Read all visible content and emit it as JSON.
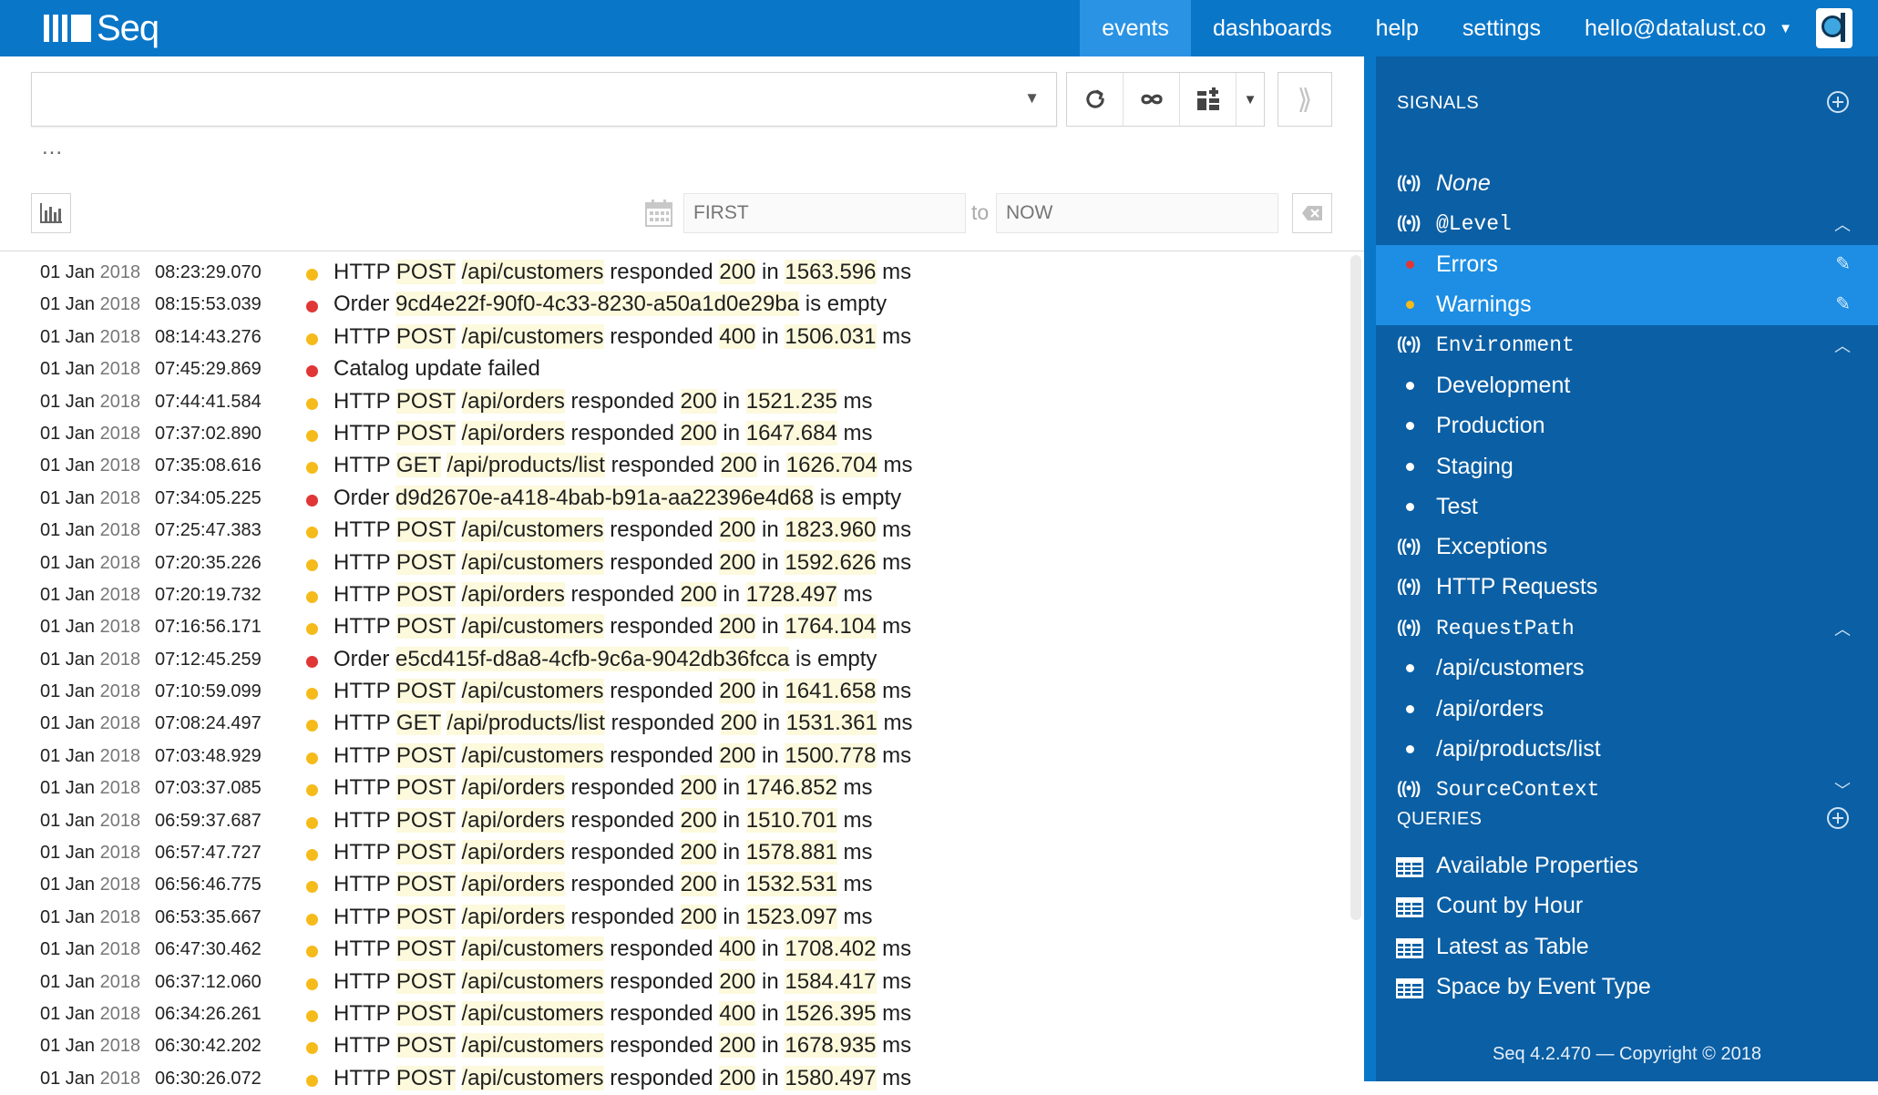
{
  "app": {
    "logo_text": "Seq",
    "nav": [
      {
        "label": "events",
        "active": true
      },
      {
        "label": "dashboards",
        "active": false
      },
      {
        "label": "help",
        "active": false
      },
      {
        "label": "settings",
        "active": false
      }
    ],
    "user": "hello@datalust.co"
  },
  "toolbar": {
    "query_value": "",
    "ellipsis": "...",
    "date_from_placeholder": "FIRST",
    "date_to_placeholder": "NOW",
    "to_label": "to"
  },
  "events": [
    {
      "date": "01 Jan",
      "year": "2018",
      "time": "08:23:29.070",
      "level": "warn",
      "segments": [
        [
          "HTTP",
          0
        ],
        [
          " ",
          0
        ],
        [
          "POST",
          1
        ],
        [
          " ",
          0
        ],
        [
          "/api/customers",
          1
        ],
        [
          " responded ",
          0
        ],
        [
          "200",
          1
        ],
        [
          " in ",
          0
        ],
        [
          "1563.596",
          1
        ],
        [
          " ms",
          0
        ]
      ]
    },
    {
      "date": "01 Jan",
      "year": "2018",
      "time": "08:15:53.039",
      "level": "err",
      "segments": [
        [
          "Order ",
          0
        ],
        [
          "9cd4e22f-90f0-4c33-8230-a50a1d0e29ba",
          1
        ],
        [
          " is empty",
          0
        ]
      ]
    },
    {
      "date": "01 Jan",
      "year": "2018",
      "time": "08:14:43.276",
      "level": "warn",
      "segments": [
        [
          "HTTP",
          0
        ],
        [
          " ",
          0
        ],
        [
          "POST",
          1
        ],
        [
          " ",
          0
        ],
        [
          "/api/customers",
          1
        ],
        [
          " responded ",
          0
        ],
        [
          "400",
          1
        ],
        [
          " in ",
          0
        ],
        [
          "1506.031",
          1
        ],
        [
          " ms",
          0
        ]
      ]
    },
    {
      "date": "01 Jan",
      "year": "2018",
      "time": "07:45:29.869",
      "level": "err",
      "segments": [
        [
          "Catalog update failed",
          0
        ]
      ]
    },
    {
      "date": "01 Jan",
      "year": "2018",
      "time": "07:44:41.584",
      "level": "warn",
      "segments": [
        [
          "HTTP",
          0
        ],
        [
          " ",
          0
        ],
        [
          "POST",
          1
        ],
        [
          " ",
          0
        ],
        [
          "/api/orders",
          1
        ],
        [
          " responded ",
          0
        ],
        [
          "200",
          1
        ],
        [
          " in ",
          0
        ],
        [
          "1521.235",
          1
        ],
        [
          " ms",
          0
        ]
      ]
    },
    {
      "date": "01 Jan",
      "year": "2018",
      "time": "07:37:02.890",
      "level": "warn",
      "segments": [
        [
          "HTTP",
          0
        ],
        [
          " ",
          0
        ],
        [
          "POST",
          1
        ],
        [
          " ",
          0
        ],
        [
          "/api/orders",
          1
        ],
        [
          " responded ",
          0
        ],
        [
          "200",
          1
        ],
        [
          " in ",
          0
        ],
        [
          "1647.684",
          1
        ],
        [
          " ms",
          0
        ]
      ]
    },
    {
      "date": "01 Jan",
      "year": "2018",
      "time": "07:35:08.616",
      "level": "warn",
      "segments": [
        [
          "HTTP",
          0
        ],
        [
          " ",
          0
        ],
        [
          "GET",
          1
        ],
        [
          " ",
          0
        ],
        [
          "/api/products/list",
          1
        ],
        [
          " responded ",
          0
        ],
        [
          "200",
          1
        ],
        [
          " in ",
          0
        ],
        [
          "1626.704",
          1
        ],
        [
          " ms",
          0
        ]
      ]
    },
    {
      "date": "01 Jan",
      "year": "2018",
      "time": "07:34:05.225",
      "level": "err",
      "segments": [
        [
          "Order ",
          0
        ],
        [
          "d9d2670e-a418-4bab-b91a-aa22396e4d68",
          1
        ],
        [
          " is empty",
          0
        ]
      ]
    },
    {
      "date": "01 Jan",
      "year": "2018",
      "time": "07:25:47.383",
      "level": "warn",
      "segments": [
        [
          "HTTP",
          0
        ],
        [
          " ",
          0
        ],
        [
          "POST",
          1
        ],
        [
          " ",
          0
        ],
        [
          "/api/customers",
          1
        ],
        [
          " responded ",
          0
        ],
        [
          "200",
          1
        ],
        [
          " in ",
          0
        ],
        [
          "1823.960",
          1
        ],
        [
          " ms",
          0
        ]
      ]
    },
    {
      "date": "01 Jan",
      "year": "2018",
      "time": "07:20:35.226",
      "level": "warn",
      "segments": [
        [
          "HTTP",
          0
        ],
        [
          " ",
          0
        ],
        [
          "POST",
          1
        ],
        [
          " ",
          0
        ],
        [
          "/api/customers",
          1
        ],
        [
          " responded ",
          0
        ],
        [
          "200",
          1
        ],
        [
          " in ",
          0
        ],
        [
          "1592.626",
          1
        ],
        [
          " ms",
          0
        ]
      ]
    },
    {
      "date": "01 Jan",
      "year": "2018",
      "time": "07:20:19.732",
      "level": "warn",
      "segments": [
        [
          "HTTP",
          0
        ],
        [
          " ",
          0
        ],
        [
          "POST",
          1
        ],
        [
          " ",
          0
        ],
        [
          "/api/orders",
          1
        ],
        [
          " responded ",
          0
        ],
        [
          "200",
          1
        ],
        [
          " in ",
          0
        ],
        [
          "1728.497",
          1
        ],
        [
          " ms",
          0
        ]
      ]
    },
    {
      "date": "01 Jan",
      "year": "2018",
      "time": "07:16:56.171",
      "level": "warn",
      "segments": [
        [
          "HTTP",
          0
        ],
        [
          " ",
          0
        ],
        [
          "POST",
          1
        ],
        [
          " ",
          0
        ],
        [
          "/api/customers",
          1
        ],
        [
          " responded ",
          0
        ],
        [
          "200",
          1
        ],
        [
          " in ",
          0
        ],
        [
          "1764.104",
          1
        ],
        [
          " ms",
          0
        ]
      ]
    },
    {
      "date": "01 Jan",
      "year": "2018",
      "time": "07:12:45.259",
      "level": "err",
      "segments": [
        [
          "Order ",
          0
        ],
        [
          "e5cd415f-d8a8-4cfb-9c6a-9042db36fcca",
          1
        ],
        [
          " is empty",
          0
        ]
      ]
    },
    {
      "date": "01 Jan",
      "year": "2018",
      "time": "07:10:59.099",
      "level": "warn",
      "segments": [
        [
          "HTTP",
          0
        ],
        [
          " ",
          0
        ],
        [
          "POST",
          1
        ],
        [
          " ",
          0
        ],
        [
          "/api/customers",
          1
        ],
        [
          " responded ",
          0
        ],
        [
          "200",
          1
        ],
        [
          " in ",
          0
        ],
        [
          "1641.658",
          1
        ],
        [
          " ms",
          0
        ]
      ]
    },
    {
      "date": "01 Jan",
      "year": "2018",
      "time": "07:08:24.497",
      "level": "warn",
      "segments": [
        [
          "HTTP",
          0
        ],
        [
          " ",
          0
        ],
        [
          "GET",
          1
        ],
        [
          " ",
          0
        ],
        [
          "/api/products/list",
          1
        ],
        [
          " responded ",
          0
        ],
        [
          "200",
          1
        ],
        [
          " in ",
          0
        ],
        [
          "1531.361",
          1
        ],
        [
          " ms",
          0
        ]
      ]
    },
    {
      "date": "01 Jan",
      "year": "2018",
      "time": "07:03:48.929",
      "level": "warn",
      "segments": [
        [
          "HTTP",
          0
        ],
        [
          " ",
          0
        ],
        [
          "POST",
          1
        ],
        [
          " ",
          0
        ],
        [
          "/api/customers",
          1
        ],
        [
          " responded ",
          0
        ],
        [
          "200",
          1
        ],
        [
          " in ",
          0
        ],
        [
          "1500.778",
          1
        ],
        [
          " ms",
          0
        ]
      ]
    },
    {
      "date": "01 Jan",
      "year": "2018",
      "time": "07:03:37.085",
      "level": "warn",
      "segments": [
        [
          "HTTP",
          0
        ],
        [
          " ",
          0
        ],
        [
          "POST",
          1
        ],
        [
          " ",
          0
        ],
        [
          "/api/orders",
          1
        ],
        [
          " responded ",
          0
        ],
        [
          "200",
          1
        ],
        [
          " in ",
          0
        ],
        [
          "1746.852",
          1
        ],
        [
          " ms",
          0
        ]
      ]
    },
    {
      "date": "01 Jan",
      "year": "2018",
      "time": "06:59:37.687",
      "level": "warn",
      "segments": [
        [
          "HTTP",
          0
        ],
        [
          " ",
          0
        ],
        [
          "POST",
          1
        ],
        [
          " ",
          0
        ],
        [
          "/api/orders",
          1
        ],
        [
          " responded ",
          0
        ],
        [
          "200",
          1
        ],
        [
          " in ",
          0
        ],
        [
          "1510.701",
          1
        ],
        [
          " ms",
          0
        ]
      ]
    },
    {
      "date": "01 Jan",
      "year": "2018",
      "time": "06:57:47.727",
      "level": "warn",
      "segments": [
        [
          "HTTP",
          0
        ],
        [
          " ",
          0
        ],
        [
          "POST",
          1
        ],
        [
          " ",
          0
        ],
        [
          "/api/orders",
          1
        ],
        [
          " responded ",
          0
        ],
        [
          "200",
          1
        ],
        [
          " in ",
          0
        ],
        [
          "1578.881",
          1
        ],
        [
          " ms",
          0
        ]
      ]
    },
    {
      "date": "01 Jan",
      "year": "2018",
      "time": "06:56:46.775",
      "level": "warn",
      "segments": [
        [
          "HTTP",
          0
        ],
        [
          " ",
          0
        ],
        [
          "POST",
          1
        ],
        [
          " ",
          0
        ],
        [
          "/api/orders",
          1
        ],
        [
          " responded ",
          0
        ],
        [
          "200",
          1
        ],
        [
          " in ",
          0
        ],
        [
          "1532.531",
          1
        ],
        [
          " ms",
          0
        ]
      ]
    },
    {
      "date": "01 Jan",
      "year": "2018",
      "time": "06:53:35.667",
      "level": "warn",
      "segments": [
        [
          "HTTP",
          0
        ],
        [
          " ",
          0
        ],
        [
          "POST",
          1
        ],
        [
          " ",
          0
        ],
        [
          "/api/orders",
          1
        ],
        [
          " responded ",
          0
        ],
        [
          "200",
          1
        ],
        [
          " in ",
          0
        ],
        [
          "1523.097",
          1
        ],
        [
          " ms",
          0
        ]
      ]
    },
    {
      "date": "01 Jan",
      "year": "2018",
      "time": "06:47:30.462",
      "level": "warn",
      "segments": [
        [
          "HTTP",
          0
        ],
        [
          " ",
          0
        ],
        [
          "POST",
          1
        ],
        [
          " ",
          0
        ],
        [
          "/api/customers",
          1
        ],
        [
          " responded ",
          0
        ],
        [
          "400",
          1
        ],
        [
          " in ",
          0
        ],
        [
          "1708.402",
          1
        ],
        [
          " ms",
          0
        ]
      ]
    },
    {
      "date": "01 Jan",
      "year": "2018",
      "time": "06:37:12.060",
      "level": "warn",
      "segments": [
        [
          "HTTP",
          0
        ],
        [
          " ",
          0
        ],
        [
          "POST",
          1
        ],
        [
          " ",
          0
        ],
        [
          "/api/customers",
          1
        ],
        [
          " responded ",
          0
        ],
        [
          "200",
          1
        ],
        [
          " in ",
          0
        ],
        [
          "1584.417",
          1
        ],
        [
          " ms",
          0
        ]
      ]
    },
    {
      "date": "01 Jan",
      "year": "2018",
      "time": "06:34:26.261",
      "level": "warn",
      "segments": [
        [
          "HTTP",
          0
        ],
        [
          " ",
          0
        ],
        [
          "POST",
          1
        ],
        [
          " ",
          0
        ],
        [
          "/api/customers",
          1
        ],
        [
          " responded ",
          0
        ],
        [
          "400",
          1
        ],
        [
          " in ",
          0
        ],
        [
          "1526.395",
          1
        ],
        [
          " ms",
          0
        ]
      ]
    },
    {
      "date": "01 Jan",
      "year": "2018",
      "time": "06:30:42.202",
      "level": "warn",
      "segments": [
        [
          "HTTP",
          0
        ],
        [
          " ",
          0
        ],
        [
          "POST",
          1
        ],
        [
          " ",
          0
        ],
        [
          "/api/customers",
          1
        ],
        [
          " responded ",
          0
        ],
        [
          "200",
          1
        ],
        [
          " in ",
          0
        ],
        [
          "1678.935",
          1
        ],
        [
          " ms",
          0
        ]
      ]
    },
    {
      "date": "01 Jan",
      "year": "2018",
      "time": "06:30:26.072",
      "level": "warn",
      "segments": [
        [
          "HTTP",
          0
        ],
        [
          " ",
          0
        ],
        [
          "POST",
          1
        ],
        [
          " ",
          0
        ],
        [
          "/api/customers",
          1
        ],
        [
          " responded ",
          0
        ],
        [
          "200",
          1
        ],
        [
          " in ",
          0
        ],
        [
          "1580.497",
          1
        ],
        [
          " ms",
          0
        ]
      ]
    }
  ],
  "sidebar": {
    "signals_title": "SIGNALS",
    "queries_title": "QUERIES",
    "signals": [
      {
        "label": "None",
        "kind": "signal",
        "style": "ital"
      },
      {
        "label": "@Level",
        "kind": "signal",
        "style": "mono",
        "chev": "up"
      },
      {
        "label": "Errors",
        "kind": "child",
        "bullet": "red",
        "selected": true
      },
      {
        "label": "Warnings",
        "kind": "child",
        "bullet": "yellow",
        "selected": true
      },
      {
        "label": "Environment",
        "kind": "signal",
        "style": "mono",
        "chev": "up"
      },
      {
        "label": "Development",
        "kind": "child",
        "bullet": "white"
      },
      {
        "label": "Production",
        "kind": "child",
        "bullet": "white"
      },
      {
        "label": "Staging",
        "kind": "child",
        "bullet": "white"
      },
      {
        "label": "Test",
        "kind": "child",
        "bullet": "white"
      },
      {
        "label": "Exceptions",
        "kind": "signal"
      },
      {
        "label": "HTTP Requests",
        "kind": "signal"
      },
      {
        "label": "RequestPath",
        "kind": "signal",
        "style": "mono",
        "chev": "up"
      },
      {
        "label": "/api/customers",
        "kind": "child",
        "bullet": "white"
      },
      {
        "label": "/api/orders",
        "kind": "child",
        "bullet": "white"
      },
      {
        "label": "/api/products/list",
        "kind": "child",
        "bullet": "white"
      },
      {
        "label": "SourceContext",
        "kind": "signal",
        "style": "mono",
        "chev": "down"
      }
    ],
    "queries": [
      "Available Properties",
      "Count by Hour",
      "Latest as Table",
      "Space by Event Type"
    ],
    "copyright": "Seq 4.2.470 — Copyright © 2018"
  },
  "colors": {
    "topbar": "#0a76c8",
    "nav_active": "#2a93e4",
    "sidebar": "#0b5fa4",
    "sidebar_selected": "#1d8ee3",
    "warning": "#f5bb1a",
    "error": "#e03636",
    "highlight": "#fcf9dd"
  },
  "icons": [
    "refresh-icon",
    "infinity-icon",
    "dashboard-add-icon",
    "chevron-down-icon",
    "expand-right-icon",
    "bar-chart-icon",
    "calendar-icon",
    "clear-icon",
    "signal-icon",
    "table-icon",
    "add-circle-icon",
    "pencil-icon"
  ]
}
